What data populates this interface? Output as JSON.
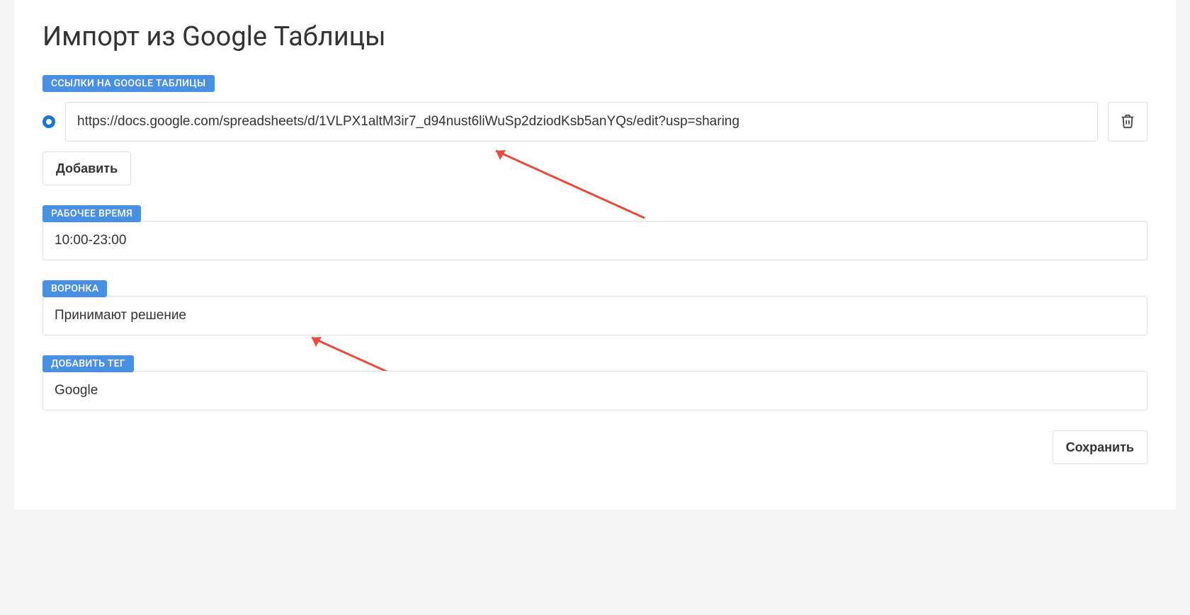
{
  "page": {
    "title": "Импорт из Google Таблицы"
  },
  "links": {
    "label": "ССЫЛКИ НА GOOGLE ТАБЛИЦЫ",
    "items": [
      {
        "url": "https://docs.google.com/spreadsheets/d/1VLPX1altM3ir7_d94nust6liWuSp2dziodKsb5anYQs/edit?usp=sharing"
      }
    ],
    "add_button": "Добавить"
  },
  "work_time": {
    "label": "РАБОЧЕЕ ВРЕМЯ",
    "value": "10:00-23:00"
  },
  "funnel": {
    "label": "ВОРОНКА",
    "selected": "Принимают решение"
  },
  "tag": {
    "label": "ДОБАВИТЬ ТЕГ",
    "value": "Google"
  },
  "actions": {
    "save": "Сохранить"
  }
}
